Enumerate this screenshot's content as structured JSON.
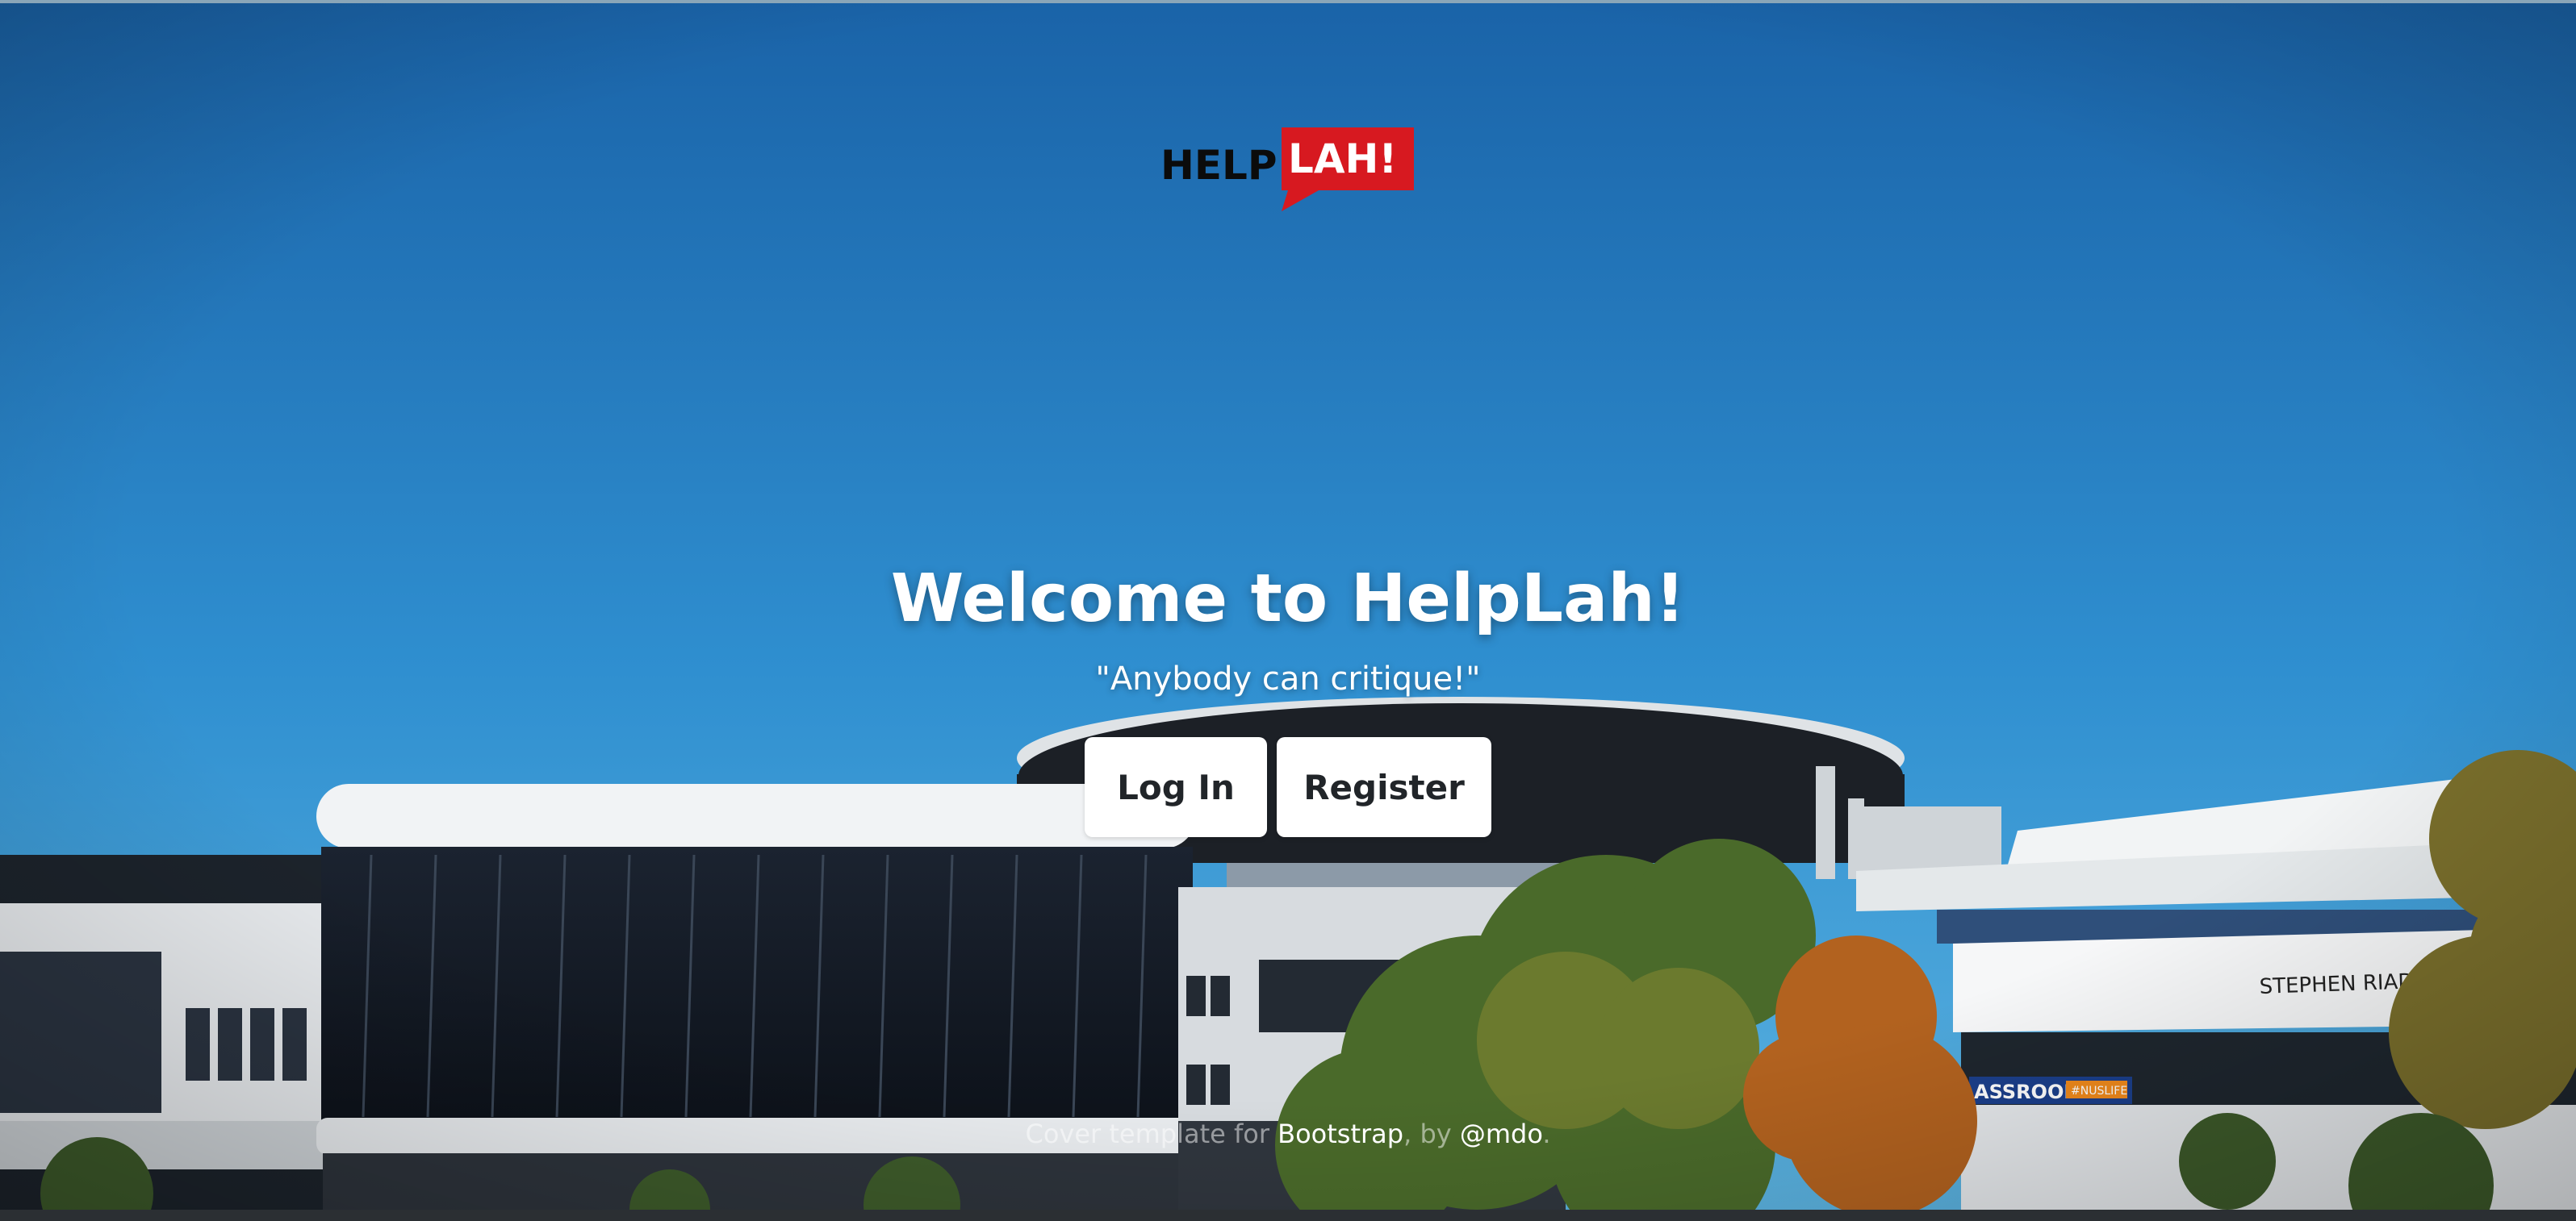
{
  "logo": {
    "part1": "HELP",
    "part2": "LAH!",
    "accent": "#d71920"
  },
  "main": {
    "title": "Welcome to HelpLah!",
    "tagline": "\"Anybody can critique!\"",
    "login_label": "Log In",
    "register_label": "Register"
  },
  "footer": {
    "prefix": "Cover template for ",
    "bootstrap_link": "Bootstrap",
    "by_text": ", by ",
    "author_link": "@mdo",
    "suffix": "."
  },
  "background": {
    "sign_text": "STEPHEN RIADY CENTRE",
    "banner_text": "ASSROOM",
    "banner_tag": "#NUSLIFE",
    "sky_top": "#1a63a8",
    "sky_bottom": "#4aa8dc"
  }
}
